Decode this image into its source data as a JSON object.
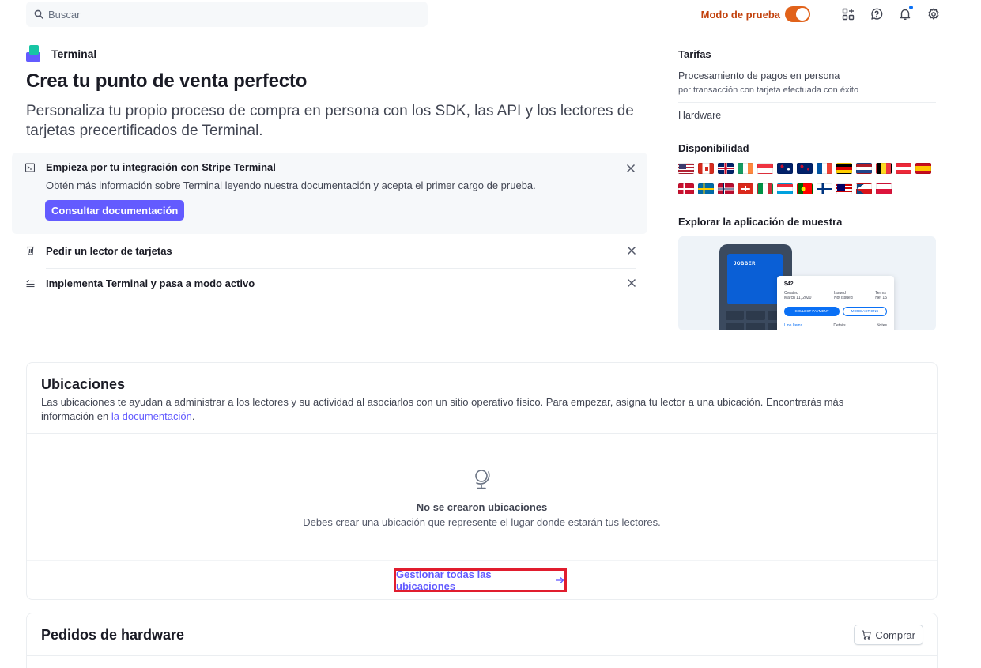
{
  "topbar": {
    "search_placeholder": "Buscar",
    "test_mode_label": "Modo de prueba",
    "test_mode_on": true,
    "icons": [
      "apps-add-icon",
      "help-icon",
      "bell-icon",
      "settings-icon"
    ]
  },
  "app": {
    "name": "Terminal",
    "title": "Crea tu punto de venta perfecto",
    "subtitle": "Personaliza tu propio proceso de compra en persona con los SDK, las API y los lectores de tarjetas precertificados de Terminal."
  },
  "tasks": {
    "active": {
      "title": "Empieza por tu integración con Stripe Terminal",
      "description": "Obtén más información sobre Terminal leyendo nuestra documentación y acepta el primer cargo de prueba.",
      "button": "Consultar documentación"
    },
    "items": [
      {
        "label": "Pedir un lector de tarjetas",
        "icon": "reader-icon"
      },
      {
        "label": "Implementa Terminal y pasa a modo activo",
        "icon": "list-check-icon"
      }
    ]
  },
  "sidebar": {
    "pricing_title": "Tarifas",
    "pricing_item": "Procesamiento de pagos en persona",
    "pricing_sub": "por transacción con tarjeta efectuada con éxito",
    "hardware": "Hardware",
    "availability_title": "Disponibilidad",
    "flags_row1": [
      "us",
      "ca",
      "gb",
      "ie",
      "sg",
      "au",
      "nz",
      "fr",
      "de",
      "nl",
      "be",
      "at",
      "es"
    ],
    "flags_row2": [
      "dk",
      "se",
      "no",
      "ch",
      "it",
      "lu",
      "pt",
      "fi",
      "my",
      "cz",
      "pl"
    ],
    "sample_title": "Explorar la aplicación de muestra",
    "sample_app": {
      "brand": "JOBBER",
      "amount": "$42",
      "fields": [
        "Created",
        "Issued",
        "Terms"
      ],
      "values": [
        "March 11, 2020",
        "Not issued",
        "Net 15"
      ],
      "primary": "COLLECT PAYMENT",
      "secondary": "MORE ACTIONS",
      "tabs": [
        "Line Items",
        "Details",
        "Notes"
      ]
    }
  },
  "locations": {
    "title": "Ubicaciones",
    "description": "Las ubicaciones te ayudan a administrar a los lectores y su actividad al asociarlos con un sitio operativo físico. Para empezar, asigna tu lector a una ubicación. Encontrarás más información en",
    "link_text": "la documentación",
    "period": ".",
    "empty_title": "No se crearon ubicaciones",
    "empty_desc": "Debes crear una ubicación que represente el lugar donde estarán tus lectores.",
    "manage_link": "Gestionar todas las ubicaciones"
  },
  "hardware_orders": {
    "title": "Pedidos de hardware",
    "buy_button": "Comprar"
  },
  "colors": {
    "accent": "#635bff",
    "test_mode": "#e1621a",
    "highlight_box": "#e11d2e"
  }
}
